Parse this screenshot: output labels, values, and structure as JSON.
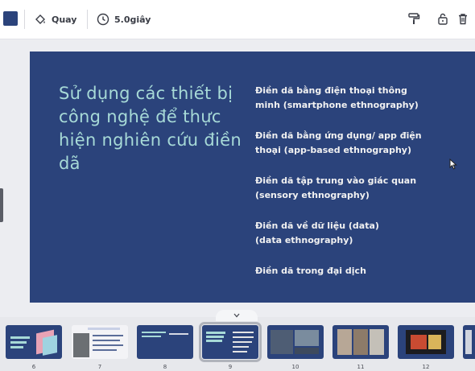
{
  "toolbar": {
    "background_color": "#2b437b",
    "transition_label": "Quay",
    "duration_label": "5.0giây",
    "icons": [
      "fill-drop-icon",
      "clock-icon",
      "paint-roller-icon",
      "lock-icon",
      "trash-icon"
    ]
  },
  "slide": {
    "background": "#2b437b",
    "title": "Sử dụng các thiết bị công nghệ để thực hiện nghiên cứu điền dã",
    "bullets": [
      "Điền dã bằng điện thoại thông\nminh (smartphone ethnography)",
      "Điền dã bằng ứng dụng/ app điện\nthoại (app-based ethnography)",
      "Điền dã tập trung vào giác quan\n(sensory ethnography)",
      "Điền dã về dữ liệu (data)\n(data ethnography)",
      "Điền dã trong đại dịch"
    ]
  },
  "filmstrip": {
    "selected": "9",
    "pages": [
      "6",
      "7",
      "8",
      "9",
      "10",
      "11",
      "12"
    ]
  }
}
